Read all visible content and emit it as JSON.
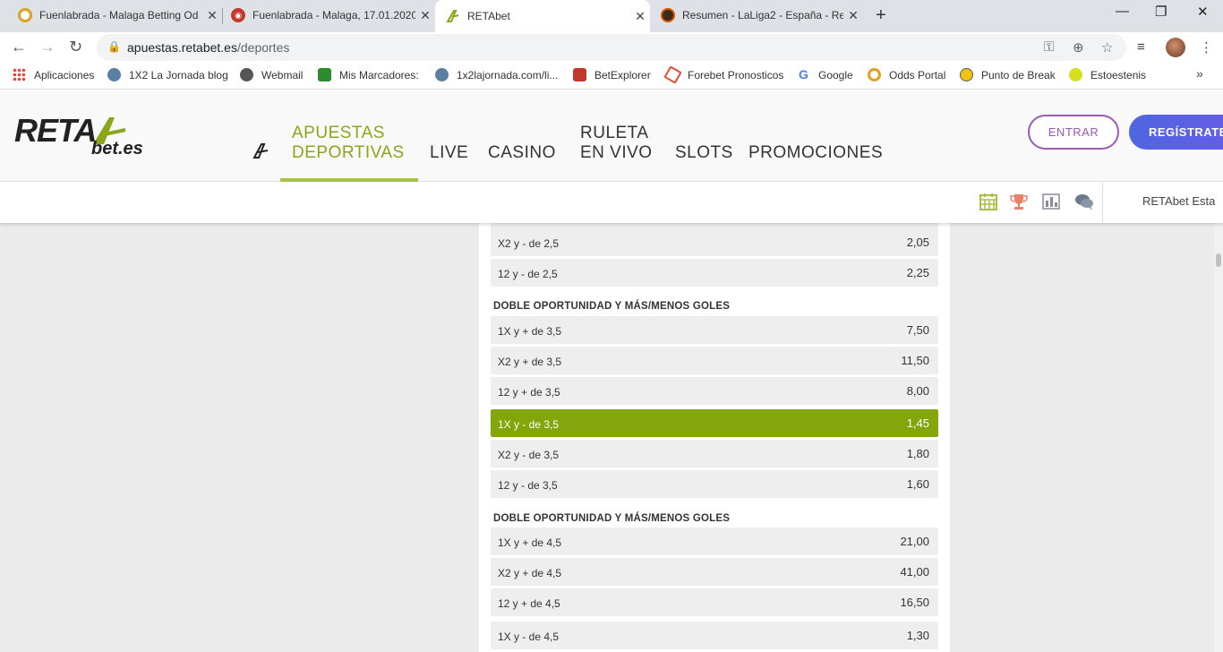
{
  "browser": {
    "tabs": [
      {
        "title": "Fuenlabrada - Malaga Betting Od",
        "fav_color": "#e0a020"
      },
      {
        "title": "Fuenlabrada - Malaga, 17.01.2020",
        "fav_color": "#c0392b"
      },
      {
        "title": "RETAbet",
        "fav_color": "#8aa61a"
      },
      {
        "title": "Resumen - LaLiga2 - España - Re",
        "fav_color": "#d35400"
      }
    ],
    "url_host": "apuestas.retabet.es",
    "url_path": "/deportes",
    "bookmarks": [
      {
        "label": "Aplicaciones",
        "color": "#ea4335"
      },
      {
        "label": "1X2 La Jornada blog",
        "color": "#5b7fa3"
      },
      {
        "label": "Webmail",
        "color": "#555555"
      },
      {
        "label": "Mis Marcadores:",
        "color": "#2e8b2e"
      },
      {
        "label": "1x2lajornada.com/li...",
        "color": "#5b7fa3"
      },
      {
        "label": "BetExplorer",
        "color": "#c0392b"
      },
      {
        "label": "Forebet Pronosticos",
        "color": "#e74c3c"
      },
      {
        "label": "Google",
        "color": "#4285f4"
      },
      {
        "label": "Odds Portal",
        "color": "#e0a020"
      },
      {
        "label": "Punto de Break",
        "color": "#f1c40f"
      },
      {
        "label": "Estoestenis",
        "color": "#d4e020"
      }
    ]
  },
  "site": {
    "logo_main": "RETA",
    "logo_sub": "bet.es",
    "nav": {
      "apuestas_1": "APUESTAS",
      "apuestas_2": "DEPORTIVAS",
      "live": "LIVE",
      "casino": "CASINO",
      "ruleta_1": "RULETA",
      "ruleta_2": "EN VIVO",
      "slots": "SLOTS",
      "promociones": "PROMOCIONES"
    },
    "btn_entrar": "ENTRAR",
    "btn_registrate": "REGÍSTRATE",
    "sub_text": "RETAbet Esta",
    "accent": "#84a60a"
  },
  "markets": {
    "group_a": [
      {
        "label": "X2 y - de 2,5",
        "odds": "2,05"
      },
      {
        "label": "12 y - de 2,5",
        "odds": "2,25"
      }
    ],
    "section_1": "DOBLE OPORTUNIDAD Y MÁS/MENOS GOLES",
    "group_b": [
      {
        "label": "1X y + de 3,5",
        "odds": "7,50"
      },
      {
        "label": "X2 y + de 3,5",
        "odds": "11,50"
      },
      {
        "label": "12 y + de 3,5",
        "odds": "8,00"
      },
      {
        "label": "1X y - de 3,5",
        "odds": "1,45"
      },
      {
        "label": "X2 y - de 3,5",
        "odds": "1,80"
      },
      {
        "label": "12 y - de 3,5",
        "odds": "1,60"
      }
    ],
    "section_2": "DOBLE OPORTUNIDAD Y MÁS/MENOS GOLES",
    "group_c": [
      {
        "label": "1X y + de 4,5",
        "odds": "21,00"
      },
      {
        "label": "X2 y + de 4,5",
        "odds": "41,00"
      },
      {
        "label": "12 y + de 4,5",
        "odds": "16,50"
      },
      {
        "label": "1X y - de 4,5",
        "odds": "1,30"
      }
    ]
  }
}
